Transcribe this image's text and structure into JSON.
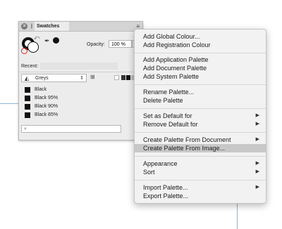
{
  "panel": {
    "tab_label": "Swatches",
    "menu_glyph": "≡",
    "opacity_label": "Opacity:",
    "opacity_value": "100 %",
    "recent_label": "Recent:",
    "palette_name": "Greys",
    "swatches": [
      {
        "name": "Black",
        "color": "#111111"
      },
      {
        "name": "Black 95%",
        "color": "#111111"
      },
      {
        "name": "Black 90%",
        "color": "#111111"
      },
      {
        "name": "Black 85%",
        "color": "#111111"
      }
    ],
    "search_placeholder": ""
  },
  "menu": {
    "items": [
      {
        "label": "Add Global Colour...",
        "submenu": false
      },
      {
        "label": "Add Registration Colour",
        "submenu": false
      },
      {
        "label": "Add Application Palette",
        "submenu": false
      },
      {
        "label": "Add Document Palette",
        "submenu": false
      },
      {
        "label": "Add System Palette",
        "submenu": false
      },
      {
        "label": "Rename Palette...",
        "submenu": false
      },
      {
        "label": "Delete Palette",
        "submenu": false
      },
      {
        "label": "Set as Default for",
        "submenu": true
      },
      {
        "label": "Remove Default for",
        "submenu": true
      },
      {
        "label": "Create Palette From Document",
        "submenu": true
      },
      {
        "label": "Create Palette From Image...",
        "submenu": false,
        "highlighted": true
      },
      {
        "label": "Appearance",
        "submenu": true
      },
      {
        "label": "Sort",
        "submenu": true
      },
      {
        "label": "Import Palette...",
        "submenu": true
      },
      {
        "label": "Export Palette...",
        "submenu": false
      }
    ],
    "submenu_glyph": "▶"
  },
  "colors": {
    "highlight": "#c8c8c8",
    "guide": "#8fb3d9"
  }
}
